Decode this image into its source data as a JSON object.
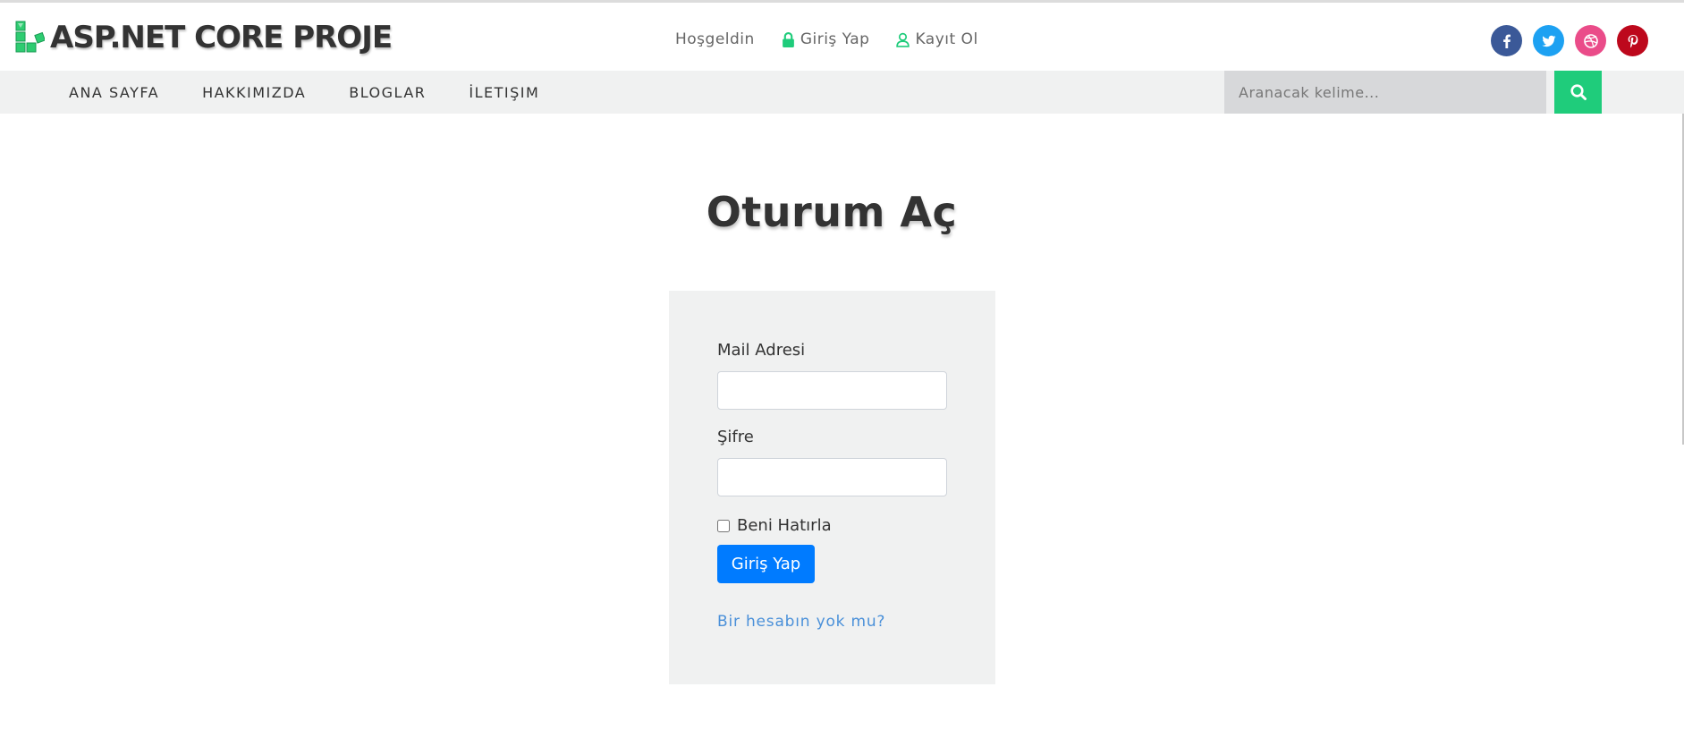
{
  "header": {
    "brand": "ASP.NET CORE PROJE",
    "links": [
      {
        "label": "Hoşgeldin",
        "icon": ""
      },
      {
        "label": "Giriş Yap",
        "icon": "lock-icon"
      },
      {
        "label": "Kayıt Ol",
        "icon": "user-icon"
      }
    ],
    "socials": [
      "facebook-icon",
      "twitter-icon",
      "dribbble-icon",
      "pinterest-icon"
    ]
  },
  "nav": {
    "items": [
      "ANA SAYFA",
      "HAKKIMIZDA",
      "BLOGLAR",
      "İLETIŞIM"
    ],
    "search_placeholder": "Aranacak kelime...",
    "search_icon": "search-icon"
  },
  "login": {
    "title": "Oturum Aç",
    "email_label": "Mail Adresi",
    "email_value": "",
    "password_label": "Şifre",
    "password_value": "",
    "remember_label": "Beni Hatırla",
    "submit_label": "Giriş Yap",
    "register_link": "Bir hesabın yok mu?"
  },
  "colors": {
    "accent_green": "#1fcc7b",
    "primary_blue": "#007bff",
    "facebook": "#3b5998",
    "twitter": "#1da1f2",
    "dribbble": "#ea4c89",
    "pinterest": "#bd081c",
    "nav_bg": "#f0f1f1"
  }
}
